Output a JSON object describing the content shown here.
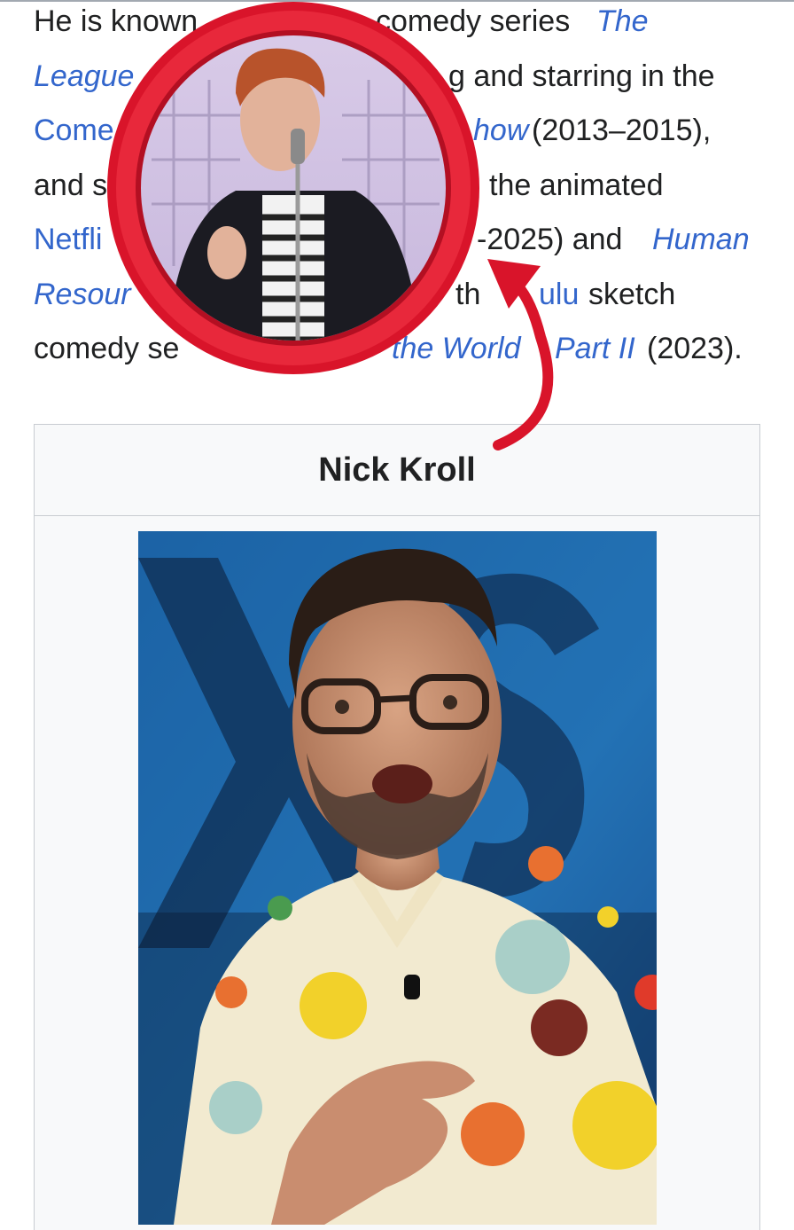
{
  "paragraph": {
    "l1a": "He is known",
    "l1b": "comedy series",
    "l1c": "The",
    "l2a": "League",
    "l2b": "g and starring in the",
    "l3a": "Come",
    "l3b": "how",
    "l3c": "(2013–2015),",
    "l4a": "and s",
    "l4b": "the animated",
    "l5a": "Netfli",
    "l5b": "-2025) and",
    "l5c": "Human",
    "l6a": "Resour",
    "l6b": "th",
    "l6c": "ulu",
    "l6d": "sketch",
    "l7a": "comedy se",
    "l7b": "the World",
    "l7c": "Part II",
    "l7d": "(2023)."
  },
  "infobox": {
    "title": "Nick Kroll"
  },
  "colors": {
    "link": "#3366cc",
    "ring": "#e3172d",
    "infobox_bg": "#f8f9fa",
    "border": "#c8ccd1"
  }
}
